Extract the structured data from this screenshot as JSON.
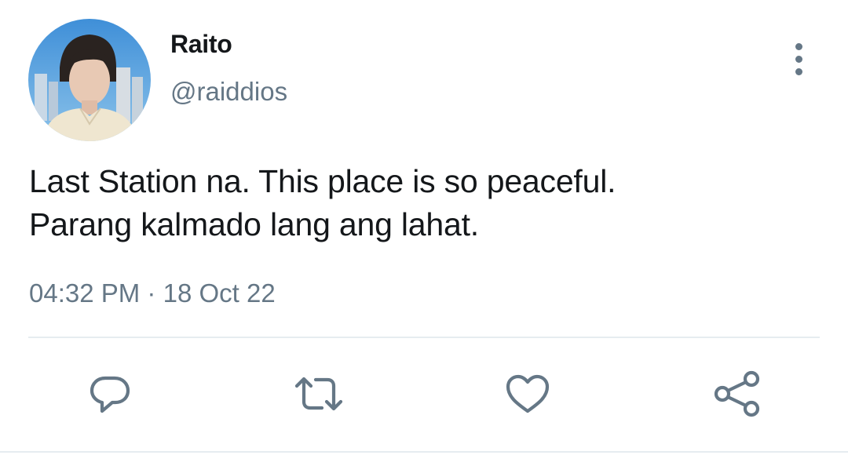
{
  "user": {
    "display_name": "Raito",
    "handle": "@raiddios"
  },
  "tweet": {
    "text_lines": [
      "Last Station na. This place is so peaceful.",
      "Parang kalmado lang ang lahat."
    ],
    "time": "04:32 PM",
    "separator": "·",
    "date": "18 Oct 22"
  },
  "actions": [
    {
      "icon": "reply-icon"
    },
    {
      "icon": "retweet-icon"
    },
    {
      "icon": "like-icon"
    },
    {
      "icon": "share-icon"
    }
  ],
  "colors": {
    "text_primary": "#14171a",
    "text_secondary": "#657786",
    "icon": "#657786",
    "divider": "#e6ecf0"
  }
}
